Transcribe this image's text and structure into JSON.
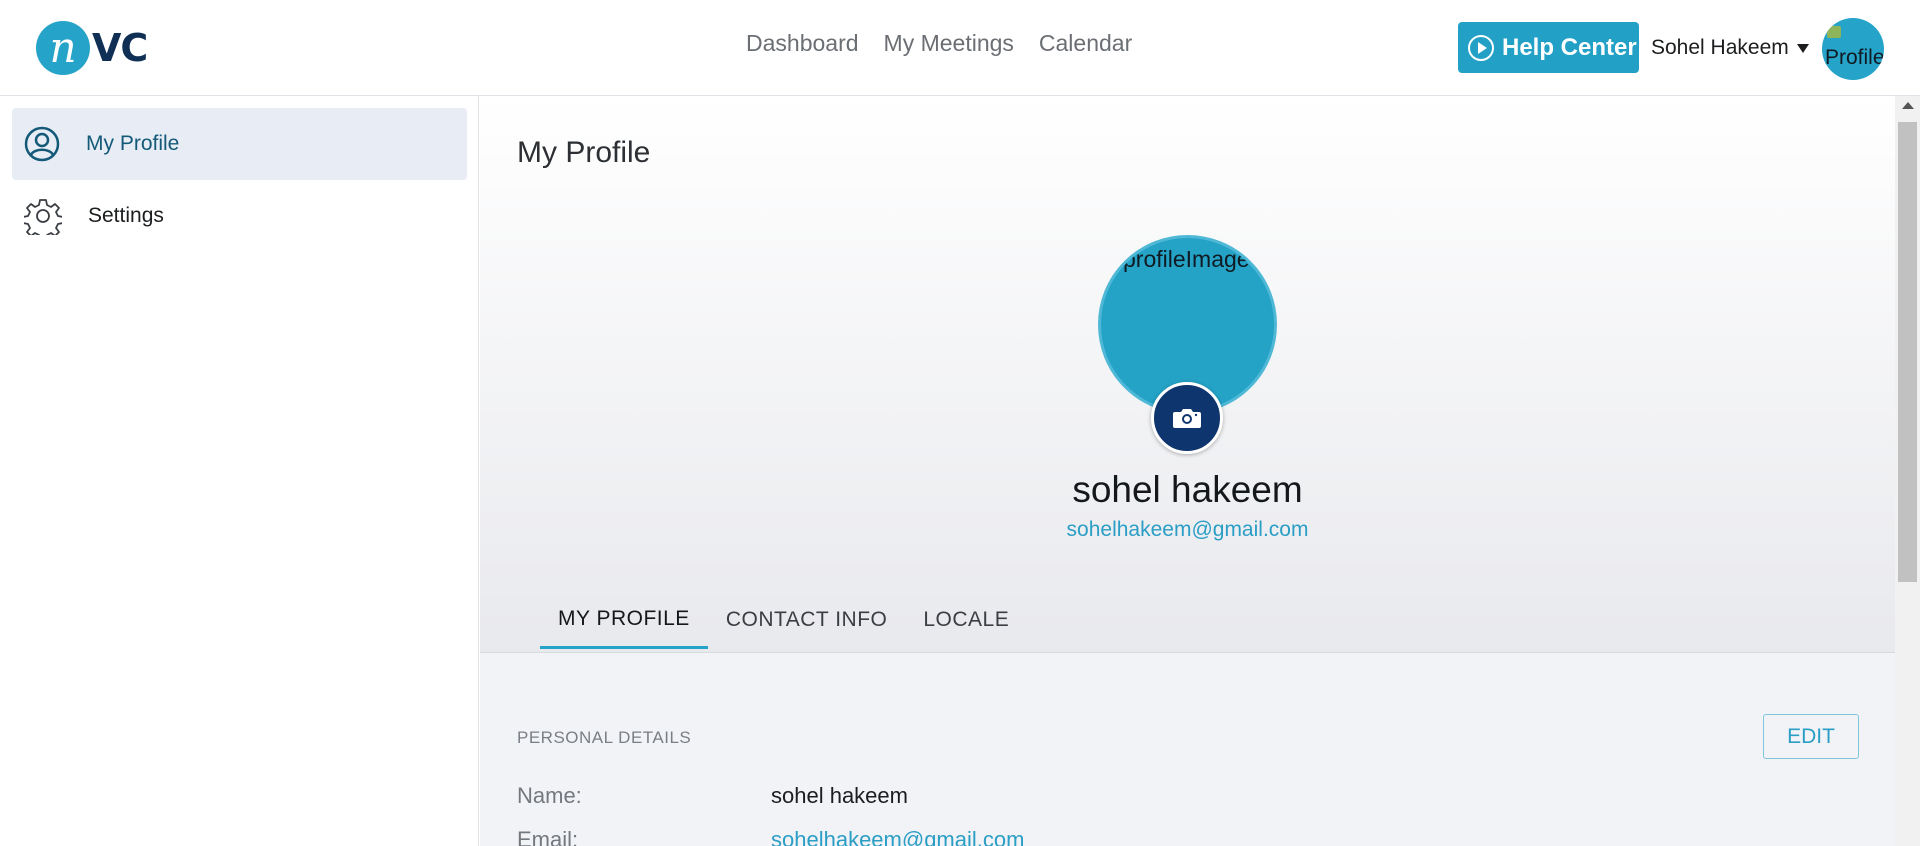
{
  "brand": {
    "logo_mark": "n",
    "logo_text": "VC"
  },
  "nav": {
    "items": [
      "Dashboard",
      "My Meetings",
      "Calendar"
    ]
  },
  "header": {
    "help_label": "Help Center",
    "user_name": "Sohel Hakeem",
    "avatar_alt": "Profile"
  },
  "sidebar": {
    "items": [
      {
        "label": "My Profile",
        "icon": "user-circle-icon",
        "active": true
      },
      {
        "label": "Settings",
        "icon": "gear-icon",
        "active": false
      }
    ]
  },
  "main": {
    "title": "My Profile",
    "profile_image_alt": "profileImage",
    "name": "sohel hakeem",
    "email": "sohelhakeem@gmail.com",
    "tabs": [
      "MY PROFILE",
      "CONTACT INFO",
      "LOCALE"
    ],
    "active_tab": "MY PROFILE"
  },
  "details": {
    "section_title": "PERSONAL DETAILS",
    "edit_label": "EDIT",
    "rows": [
      {
        "label": "Name:",
        "value": "sohel hakeem"
      },
      {
        "label": "Email:",
        "value": "sohelhakeem@gmail.com"
      }
    ]
  },
  "colors": {
    "accent": "#26a3c9",
    "brand_dark": "#0f2f55",
    "camera_button": "#0f356e",
    "active_sidebar_bg": "#e8edf5"
  }
}
